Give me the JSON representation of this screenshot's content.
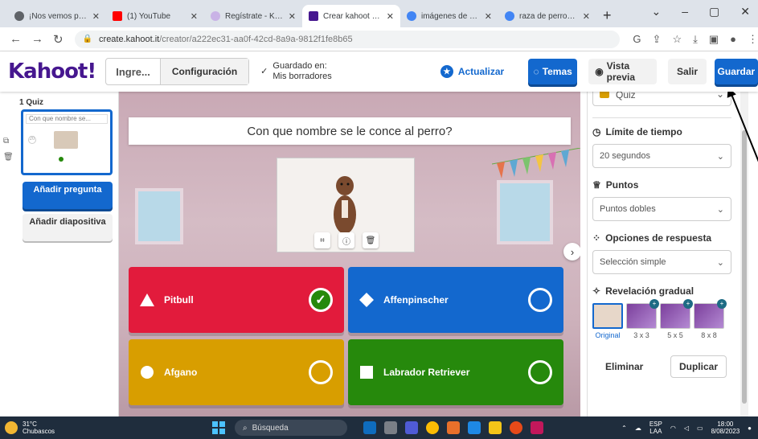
{
  "browser": {
    "tabs": [
      {
        "title": "¡Nos vemos pronto",
        "color": "#5f6368"
      },
      {
        "title": "(1) YouTube",
        "color": "#ff0000"
      },
      {
        "title": "Regístrate - Kahoot",
        "color": "#46178f"
      },
      {
        "title": "Crear kahoot - Kah",
        "color": "#46178f"
      },
      {
        "title": "imágenes de perro",
        "color": "#4285f4"
      },
      {
        "title": "raza de perros - Bu",
        "color": "#4285f4"
      }
    ],
    "new_tab": "+",
    "url_host": "create.kahoot.it",
    "url_path": "/creator/a222ec31-aa0f-42cd-8a9a-9812f1fe8b65"
  },
  "header": {
    "title_abbrev": "Ingre...",
    "config_label": "Configuración",
    "saved_text": "Guardado en: Mis borradores",
    "update_label": "Actualizar",
    "themes_label": "Temas",
    "preview_label": "Vista previa",
    "exit_label": "Salir",
    "save_label": "Guardar"
  },
  "sidebar": {
    "slide_label": "1 Quiz",
    "thumb_text": "Con que nombre se...",
    "thumb_badge": "20",
    "add_question": "Añadir pregunta",
    "add_slide": "Añadir diapositiva"
  },
  "question": {
    "text": "Con que nombre se le conce al perro?",
    "answers": [
      {
        "text": "Pitbull",
        "color": "#e21b3c",
        "correct": true
      },
      {
        "text": "Affenpinscher",
        "color": "#1368ce",
        "correct": false
      },
      {
        "text": "Afgano",
        "color": "#d89e00",
        "correct": false
      },
      {
        "text": "Labrador Retriever",
        "color": "#26890c",
        "correct": false
      }
    ]
  },
  "settings": {
    "type": "Quiz",
    "time_label": "Límite de tiempo",
    "time_value": "20 segundos",
    "points_label": "Puntos",
    "points_value": "Puntos dobles",
    "answer_options_label": "Opciones de respuesta",
    "answer_options_value": "Selección simple",
    "reveal_label": "Revelación gradual",
    "reveal_options": [
      "Original",
      "3 x 3",
      "5 x 5",
      "8 x 8"
    ],
    "delete_label": "Eliminar",
    "duplicate_label": "Duplicar"
  },
  "taskbar": {
    "temp": "31°C",
    "weather": "Chubascos",
    "search_label": "Búsqueda",
    "lang": "ESP",
    "layout": "LAA",
    "time": "18:00",
    "date": "8/08/2023"
  }
}
